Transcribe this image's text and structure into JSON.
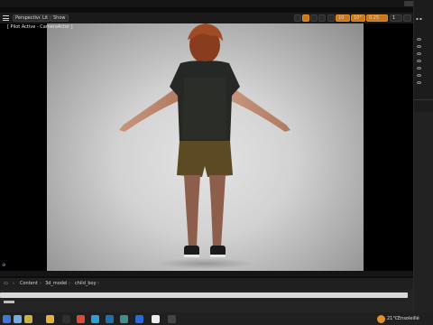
{
  "toolbar": {
    "perspective_label": "Perspective",
    "lit_label": "Lit",
    "show_label": "Show",
    "snap_value": "10",
    "rotate_snap_value": "10°",
    "scale_snap_value": "0.25",
    "camera_speed_value": "1"
  },
  "viewport": {
    "pilot_text": "[ Pilot Active - CameraActor ]"
  },
  "content_browser": {
    "breadcrumbs": [
      "Content",
      "3d_model",
      "child_boy"
    ]
  },
  "taskbar": {
    "weather": "21°C",
    "weather_text": "Ensoleillé",
    "icons": [
      "windows-start",
      "search",
      "task-view",
      "file-explorer",
      "chrome",
      "edge",
      "store",
      "settings",
      "photos",
      "unreal",
      "mail"
    ]
  },
  "colors": {
    "accent": "#c8781f",
    "viewport_bg": "#000000",
    "panel_bg": "#1c1c1c"
  }
}
